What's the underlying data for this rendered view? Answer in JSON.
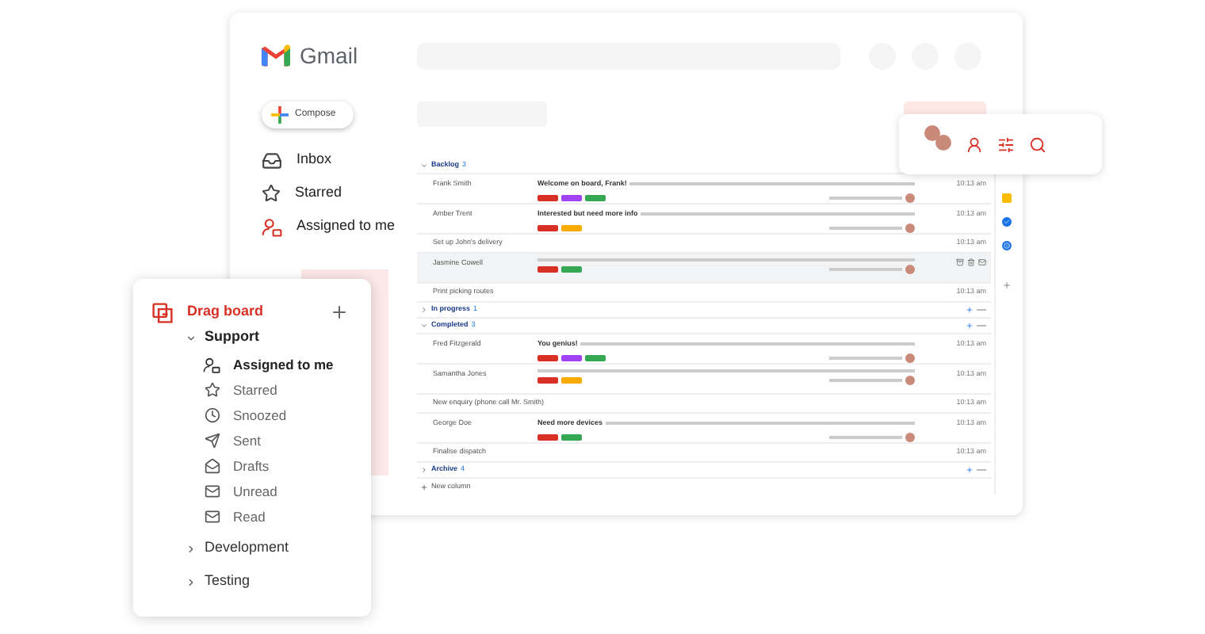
{
  "app": {
    "name": "Gmail"
  },
  "compose": {
    "label": "Compose"
  },
  "nav": [
    {
      "label": "Inbox",
      "selected": false
    },
    {
      "label": "Starred",
      "selected": false
    },
    {
      "label": "Assigned to me",
      "selected": true
    }
  ],
  "board": {
    "groups": [
      {
        "name": "Backlog",
        "count": "3",
        "expanded": true,
        "rows": [
          {
            "kind": "email",
            "sender": "Frank Smith",
            "subject": "Welcome on board, Frank!",
            "tags": [
              {
                "color": "#d93025"
              },
              {
                "color": "#a142f4"
              },
              {
                "color": "#34a853"
              }
            ],
            "time": "10:13 am",
            "selected": false
          },
          {
            "kind": "email",
            "sender": "Amber Trent",
            "subject": "Interested but need more info",
            "tags": [
              {
                "color": "#d93025"
              },
              {
                "color": "#f9ab00"
              }
            ],
            "time": "10:13 am",
            "selected": false
          },
          {
            "kind": "task",
            "sender": "Set up John's delivery",
            "time": "10:13 am",
            "selected": false
          },
          {
            "kind": "email",
            "sender": "Jasmine Cowell",
            "tags": [
              {
                "color": "#d93025"
              },
              {
                "color": "#34a853"
              }
            ],
            "selected": true
          },
          {
            "kind": "task",
            "sender": "Print picking routes",
            "time": "10:13 am",
            "selected": false
          }
        ]
      },
      {
        "name": "In progress",
        "count": "1",
        "expanded": false
      },
      {
        "name": "Completed",
        "count": "3",
        "expanded": true,
        "rows": [
          {
            "kind": "email",
            "sender": "Fred Fitzgerald",
            "subject": "You genius!",
            "tags": [
              {
                "color": "#d93025"
              },
              {
                "color": "#a142f4"
              },
              {
                "color": "#34a853"
              }
            ],
            "time": "10:13 am",
            "selected": false
          },
          {
            "kind": "email",
            "sender": "Samantha Jones",
            "tags": [
              {
                "color": "#d93025"
              },
              {
                "color": "#f9ab00"
              }
            ],
            "time": "10:13 am",
            "selected": false
          },
          {
            "kind": "task",
            "sender": "New enquiry (phone call Mr. Smith)",
            "time": "10:13 am",
            "selected": false
          },
          {
            "kind": "email",
            "sender": "George Doe",
            "subject": "Need more devices",
            "tags": [
              {
                "color": "#d93025"
              },
              {
                "color": "#34a853"
              }
            ],
            "time": "10:13 am",
            "selected": false
          },
          {
            "kind": "task",
            "sender": "Finalise dispatch",
            "time": "10:13 am",
            "selected": false
          }
        ]
      },
      {
        "name": "Archive",
        "count": "4",
        "expanded": false
      }
    ],
    "new_column": "New column"
  },
  "drag_board": {
    "title": "Drag board",
    "folders": [
      {
        "label": "Support",
        "expanded": true,
        "items": [
          {
            "label": "Assigned to me",
            "selected": true
          },
          {
            "label": "Starred",
            "selected": false
          },
          {
            "label": "Snoozed",
            "selected": false
          },
          {
            "label": "Sent",
            "selected": false
          },
          {
            "label": "Drafts",
            "selected": false
          },
          {
            "label": "Unread",
            "selected": false
          },
          {
            "label": "Read",
            "selected": false
          }
        ]
      },
      {
        "label": "Development",
        "expanded": false
      },
      {
        "label": "Testing",
        "expanded": false
      }
    ]
  }
}
